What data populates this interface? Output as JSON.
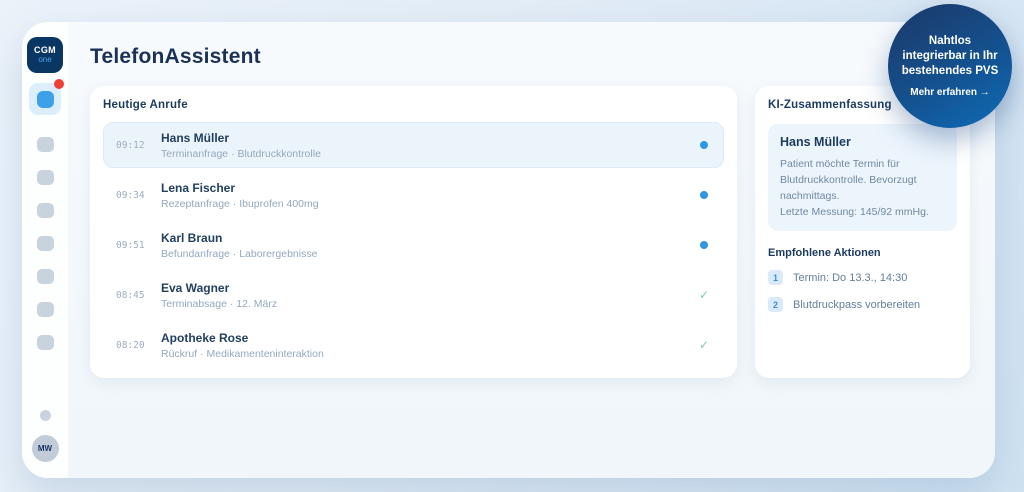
{
  "app": {
    "title": "TelefonAssistent",
    "logo": {
      "line1": "CGM",
      "line2": "one"
    },
    "avatar_initials": "MW"
  },
  "calls": {
    "title": "Heutige Anrufe",
    "items": [
      {
        "time": "09:12",
        "name": "Hans Müller",
        "subtitle": "Terminanfrage · Blutdruckkontrolle",
        "status": "new"
      },
      {
        "time": "09:34",
        "name": "Lena Fischer",
        "subtitle": "Rezeptanfrage · Ibuprofen 400mg",
        "status": "new"
      },
      {
        "time": "09:51",
        "name": "Karl Braun",
        "subtitle": "Befundanfrage · Laborergebnisse",
        "status": "new"
      },
      {
        "time": "08:45",
        "name": "Eva Wagner",
        "subtitle": "Terminabsage · 12. März",
        "status": "done"
      },
      {
        "time": "08:20",
        "name": "Apotheke Rose",
        "subtitle": "Rückruf · Medikamenteninteraktion",
        "status": "done"
      }
    ]
  },
  "ki": {
    "title": "KI-Zusammenfassung",
    "summary": {
      "name": "Hans Müller",
      "lines": [
        "Patient möchte Termin für",
        "Blutdruckkontrolle. Bevorzugt nachmittags.",
        "Letzte Messung: 145/92 mmHg."
      ]
    },
    "actions_title": "Empfohlene Aktionen",
    "actions": [
      {
        "number": "1",
        "label": "Termin: Do 13.3., 14:30"
      },
      {
        "number": "2",
        "label": "Blutdruckpass vorbereiten"
      }
    ]
  },
  "promo": {
    "lines": [
      "Nahtlos",
      "integrierbar in Ihr",
      "bestehendes PVS"
    ],
    "cta": "Mehr erfahren →"
  },
  "icons": {
    "check_glyph": "✓",
    "unread_dot": "blue-dot",
    "notification_dot": "red-dot"
  },
  "colors": {
    "accent_blue": "#3da0e8",
    "navy": "#1c3156",
    "notification_red": "#ef4036",
    "check_teal": "#82c6bd",
    "promo_gradient_start": "#1c3a6a",
    "promo_gradient_end": "#0e6cb8"
  }
}
